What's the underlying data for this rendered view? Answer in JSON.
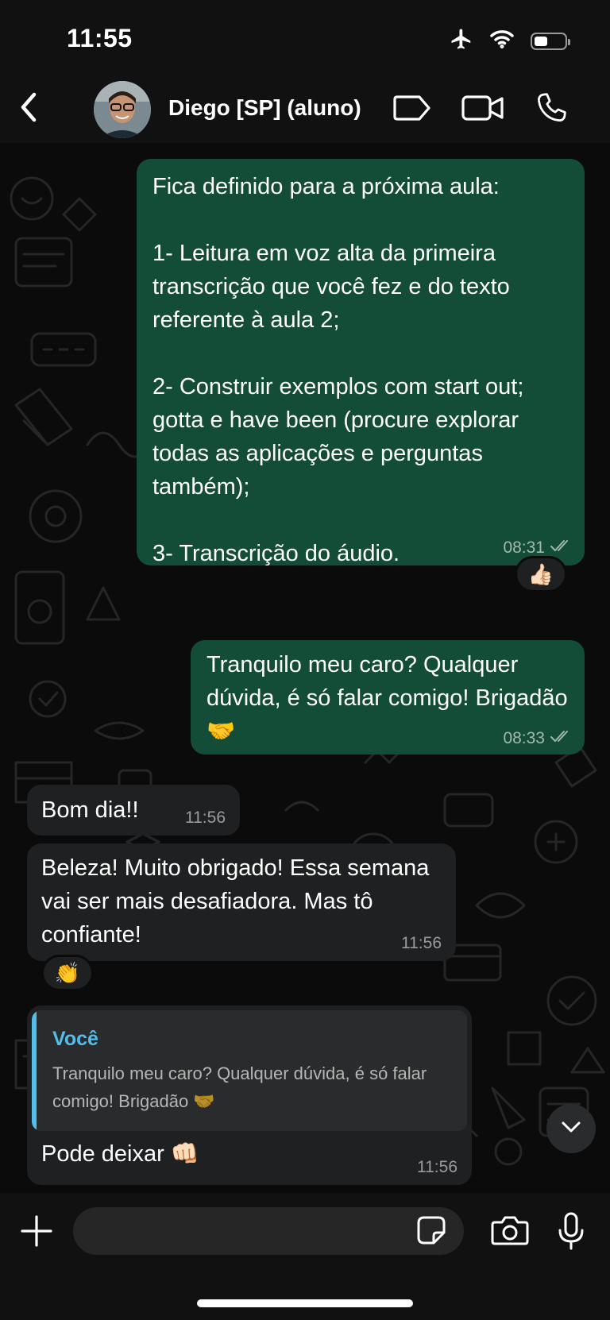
{
  "status_bar": {
    "time": "11:55"
  },
  "header": {
    "contact_name": "Diego [SP] (aluno)"
  },
  "messages": [
    {
      "direction": "outgoing",
      "text": "Fica definido para a próxima aula:\n\n1- Leitura em voz alta da primeira transcrição que você fez e do texto referente à aula 2;\n\n2- Construir exemplos com start out; gotta e have been (procure explorar todas as aplicações e perguntas também);\n\n3- Transcrição do áudio.",
      "time": "08:31",
      "reaction": "👍🏻"
    },
    {
      "direction": "outgoing",
      "text": "Tranquilo meu caro? Qualquer dúvida, é só falar comigo! Brigadão 🤝",
      "time": "08:33"
    },
    {
      "direction": "incoming",
      "text": "Bom dia!!",
      "time": "11:56"
    },
    {
      "direction": "incoming",
      "text": "Beleza! Muito obrigado! Essa semana vai ser mais desafiadora. Mas tô confiante!",
      "time": "11:56",
      "reaction": "👏"
    },
    {
      "direction": "incoming",
      "quoted_author": "Você",
      "quoted_text": "Tranquilo meu caro? Qualquer dúvida, é só falar comigo! Brigadão 🤝",
      "text": "Pode deixar 👊🏻",
      "time": "11:56"
    }
  ],
  "input": {
    "placeholder": ""
  },
  "icons": {
    "back": "chevron-left-icon",
    "label": "label-tag-icon",
    "video": "video-camera-icon",
    "call": "phone-icon",
    "attach": "plus-icon",
    "sticker": "sticker-icon",
    "camera": "camera-icon",
    "mic": "microphone-icon",
    "scroll_down": "chevron-down-icon",
    "read_receipt": "double-check-icon"
  },
  "colors": {
    "outgoing_bubble": "#144d37",
    "incoming_bubble": "#1f2021",
    "quote_accent": "#53bdeb",
    "background": "#0b0b0b"
  }
}
